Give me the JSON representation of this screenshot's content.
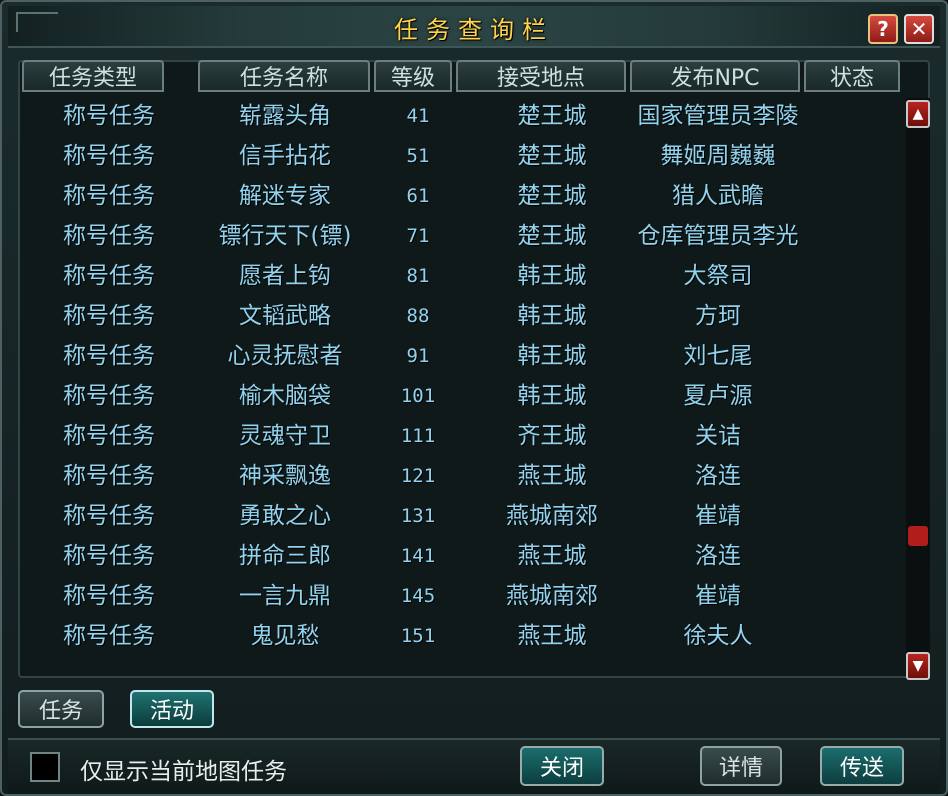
{
  "window": {
    "title": "任务查询栏",
    "help_label": "?",
    "close_label": "✕"
  },
  "columns": [
    "任务类型",
    "任务名称",
    "等级",
    "接受地点",
    "发布NPC",
    "状态"
  ],
  "rows": [
    {
      "type": "称号任务",
      "name": "崭露头角",
      "level": "41",
      "location": "楚王城",
      "npc": "国家管理员李陵",
      "status": ""
    },
    {
      "type": "称号任务",
      "name": "信手拈花",
      "level": "51",
      "location": "楚王城",
      "npc": "舞姬周巍巍",
      "status": ""
    },
    {
      "type": "称号任务",
      "name": "解迷专家",
      "level": "61",
      "location": "楚王城",
      "npc": "猎人武瞻",
      "status": ""
    },
    {
      "type": "称号任务",
      "name": "镖行天下(镖)",
      "level": "71",
      "location": "楚王城",
      "npc": "仓库管理员李光",
      "status": ""
    },
    {
      "type": "称号任务",
      "name": "愿者上钩",
      "level": "81",
      "location": "韩王城",
      "npc": "大祭司",
      "status": ""
    },
    {
      "type": "称号任务",
      "name": "文韬武略",
      "level": "88",
      "location": "韩王城",
      "npc": "方珂",
      "status": ""
    },
    {
      "type": "称号任务",
      "name": "心灵抚慰者",
      "level": "91",
      "location": "韩王城",
      "npc": "刘七尾",
      "status": ""
    },
    {
      "type": "称号任务",
      "name": "榆木脑袋",
      "level": "101",
      "location": "韩王城",
      "npc": "夏卢源",
      "status": ""
    },
    {
      "type": "称号任务",
      "name": "灵魂守卫",
      "level": "111",
      "location": "齐王城",
      "npc": "关诘",
      "status": ""
    },
    {
      "type": "称号任务",
      "name": "神采飘逸",
      "level": "121",
      "location": "燕王城",
      "npc": "洛连",
      "status": ""
    },
    {
      "type": "称号任务",
      "name": "勇敢之心",
      "level": "131",
      "location": "燕城南郊",
      "npc": "崔靖",
      "status": ""
    },
    {
      "type": "称号任务",
      "name": "拼命三郎",
      "level": "141",
      "location": "燕王城",
      "npc": "洛连",
      "status": ""
    },
    {
      "type": "称号任务",
      "name": "一言九鼎",
      "level": "145",
      "location": "燕城南郊",
      "npc": "崔靖",
      "status": ""
    },
    {
      "type": "称号任务",
      "name": "鬼见愁",
      "level": "151",
      "location": "燕王城",
      "npc": "徐夫人",
      "status": ""
    }
  ],
  "scrollbar": {
    "up_icon": "triangle-up-icon",
    "down_icon": "triangle-down-icon",
    "position": 0.78
  },
  "tabs": {
    "task": "任务",
    "activity": "活动"
  },
  "filter": {
    "label": "仅显示当前地图任务",
    "checked": false
  },
  "buttons": {
    "close": "关闭",
    "details": "详情",
    "teleport": "传送"
  },
  "colors": {
    "title": "#ffd34a",
    "cell_text": "#92d2ee",
    "accent_red": "#b8241d"
  }
}
